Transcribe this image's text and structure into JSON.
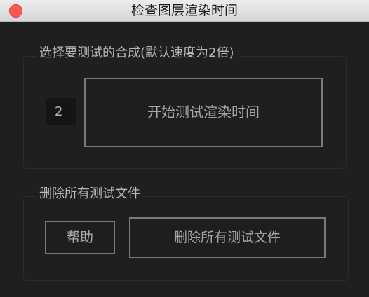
{
  "window": {
    "title": "检查图层渲染时间"
  },
  "render_group": {
    "label": "选择要测试的合成(默认速度为2倍)",
    "speed_value": "2",
    "start_button_label": "开始测试渲染时间"
  },
  "delete_group": {
    "label": "删除所有测试文件",
    "help_button_label": "帮助",
    "delete_button_label": "删除所有测试文件"
  },
  "colors": {
    "close_button": "#fc5753",
    "background": "#1f1f1f",
    "button_border": "#7a7a7a"
  }
}
